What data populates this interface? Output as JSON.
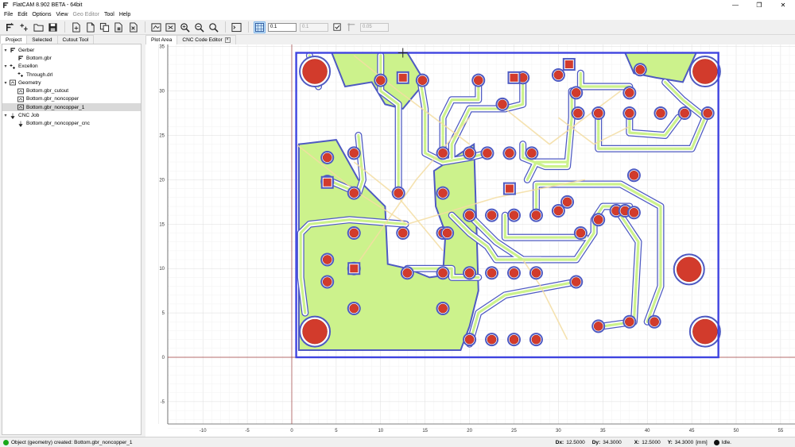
{
  "window": {
    "title": "FlatCAM 8.902 BETA - 64bit",
    "min": "—",
    "max": "❐",
    "close": "✕"
  },
  "menu": [
    "File",
    "Edit",
    "Options",
    "View",
    "Geo Editor",
    "Tool",
    "Help"
  ],
  "menu_disabled_index": 4,
  "toolbar": {
    "grid_x_value": "0.1",
    "grid_y_value": "0.1",
    "snap_distance_value": "0.05",
    "icons": [
      "open-gerber-icon",
      "open-excellon-icon",
      "open-project-icon",
      "save-project-icon",
      "new-geometry-icon",
      "new-gerber-icon",
      "copy-icon",
      "delete-icon",
      "clear-plot-icon",
      "replot-icon",
      "zoom-fit-icon",
      "zoom-in-icon",
      "zoom-out-icon",
      "shell-icon",
      "snap-grid-icon",
      "snap-corner-icon"
    ]
  },
  "left_tabs": [
    "Project",
    "Selected",
    "Cutout Tool"
  ],
  "tree": [
    {
      "label": "Gerber",
      "level": 0,
      "expanded": true,
      "icon": "gerber-icon"
    },
    {
      "label": "Bottom.gbr",
      "level": 1,
      "icon": "gerber-file-icon"
    },
    {
      "label": "Excellon",
      "level": 0,
      "expanded": true,
      "icon": "excellon-icon"
    },
    {
      "label": "Through.drl",
      "level": 1,
      "icon": "drill-file-icon"
    },
    {
      "label": "Geometry",
      "level": 0,
      "expanded": true,
      "icon": "geometry-icon"
    },
    {
      "label": "Bottom.gbr_cutout",
      "level": 1,
      "icon": "geometry-file-icon"
    },
    {
      "label": "Bottom.gbr_noncopper",
      "level": 1,
      "icon": "geometry-file-icon"
    },
    {
      "label": "Bottom.gbr_noncopper_1",
      "level": 1,
      "icon": "geometry-file-icon",
      "selected": true
    },
    {
      "label": "CNC Job",
      "level": 0,
      "expanded": true,
      "icon": "cnc-icon"
    },
    {
      "label": "Bottom.gbr_noncopper_cnc",
      "level": 1,
      "icon": "cnc-file-icon"
    }
  ],
  "plot_tabs": [
    {
      "label": "Plot Area"
    },
    {
      "label": "CNC Code Editor",
      "closable": true
    }
  ],
  "plot": {
    "x_ticks": [
      "-10",
      "-5",
      "0",
      "5",
      "10",
      "15",
      "20",
      "25",
      "30",
      "35",
      "40",
      "45",
      "50",
      "55"
    ],
    "x_tick_values": [
      -10,
      -5,
      0,
      5,
      10,
      15,
      20,
      25,
      30,
      35,
      40,
      45,
      50,
      55
    ],
    "y_ticks": [
      "-5",
      "0",
      "5",
      "10",
      "15",
      "20",
      "25",
      "30",
      "35"
    ],
    "y_tick_values": [
      -5,
      0,
      5,
      10,
      15,
      20,
      25,
      30,
      35
    ],
    "board_x": [
      0,
      48
    ],
    "board_y": [
      0,
      34.3
    ],
    "colors": {
      "copper": "#ccf28c",
      "trace_outline": "#4e5ac2",
      "pad": "#d23b2c",
      "pad_edge": "#a72a1f",
      "board_outline": "#3f44e0",
      "cnc_path": "#f3dda2",
      "axis": "#a04040",
      "grid": "#e6e6e6"
    }
  },
  "status": {
    "message": "Object (geometry) created: Bottom.gbr_noncopper_1",
    "dx_label": "Dx:",
    "dx": "12.5000",
    "dy_label": "Dy:",
    "dy": "34.3000",
    "x_label": "X:",
    "x": "12.5000",
    "y_label": "Y:",
    "y": "34.3000",
    "units": "[mm]",
    "state": "Idle."
  }
}
